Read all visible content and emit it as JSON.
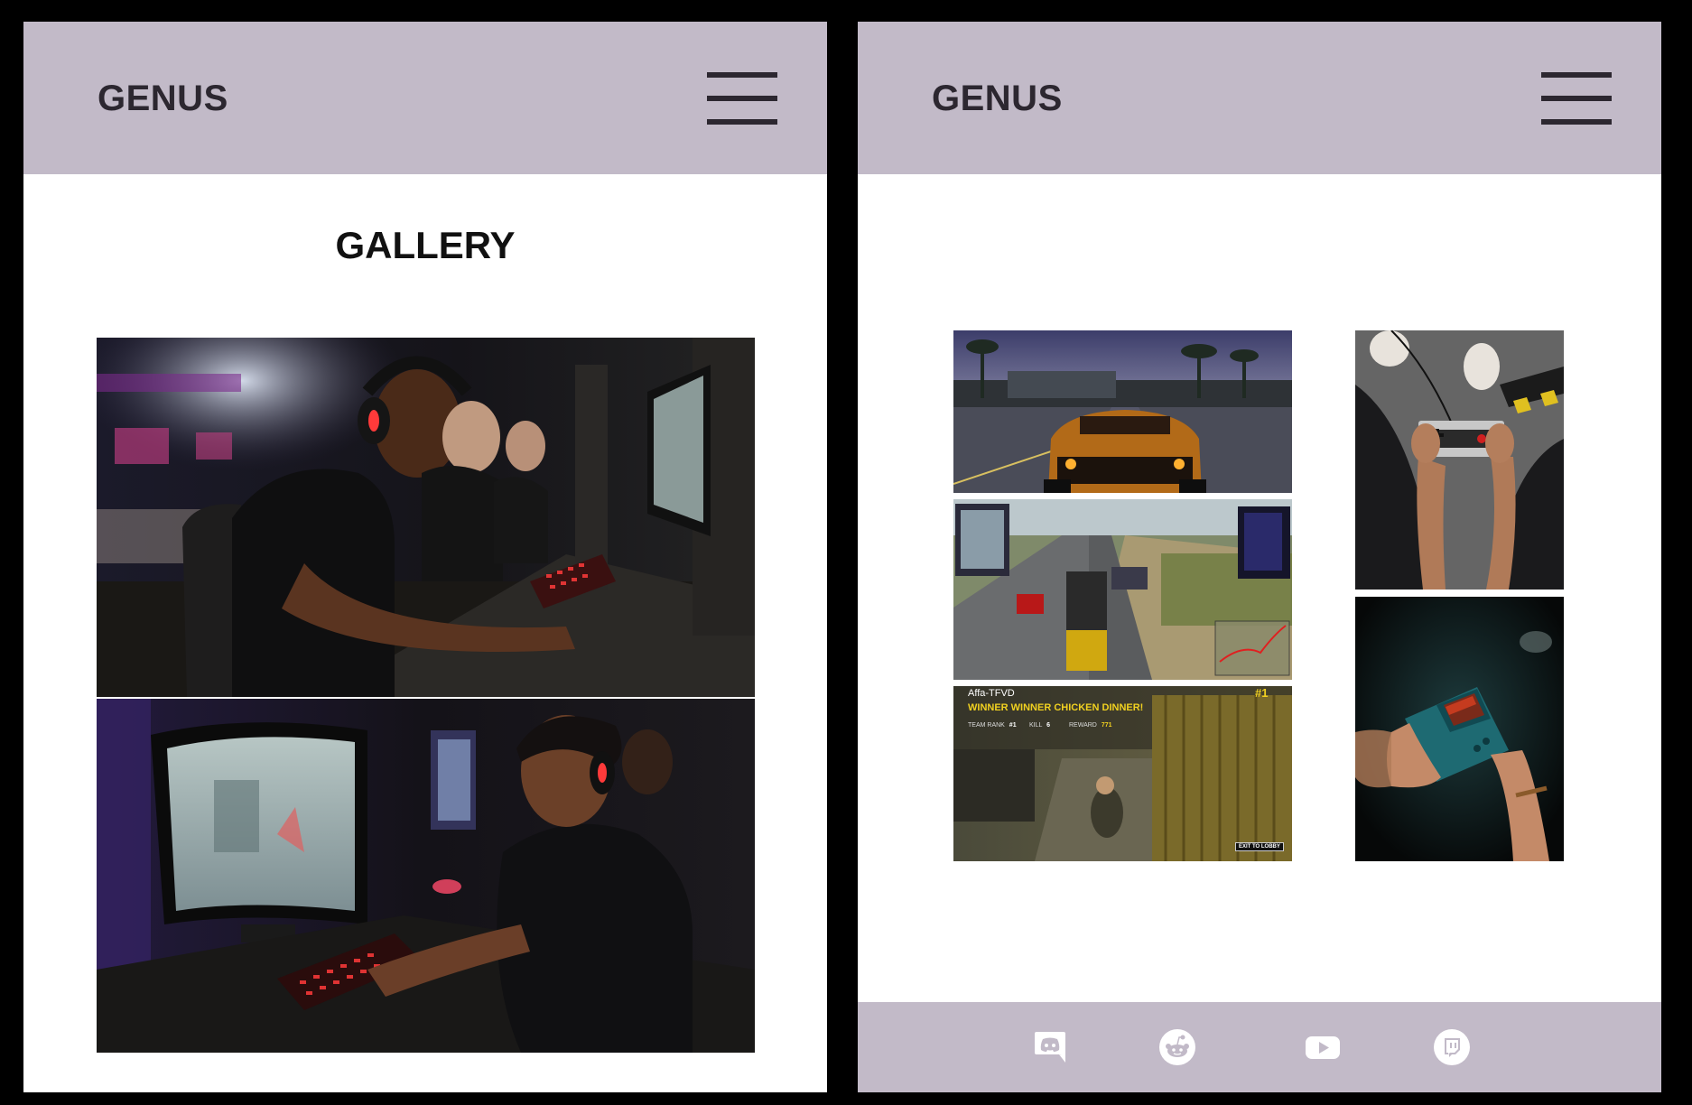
{
  "left_screen": {
    "brand": "GENUS",
    "menu_icon": "hamburger-menu-icon",
    "title": "GALLERY",
    "photos": [
      {
        "subject": "man-playing-pc-game-photo"
      },
      {
        "subject": "teen-playing-pc-game-photo"
      }
    ]
  },
  "right_screen": {
    "brand": "GENUS",
    "menu_icon": "hamburger-menu-icon",
    "photos": [
      {
        "subject": "racing-game-screenshot"
      },
      {
        "subject": "highway-battle-royale-screenshot"
      },
      {
        "subject": "battle-royale-victory-screenshot",
        "overlay": {
          "player": "Affa-TFVD",
          "banner": "WINNER WINNER CHICKEN DINNER!",
          "rank": "#1",
          "team_rank": "TEAM RANK",
          "team_rank_value": "#1",
          "kill": "KILL",
          "kill_value": "6",
          "reward": "REWARD",
          "reward_value": "771",
          "exit_button": "EXIT TO LOBBY"
        }
      },
      {
        "subject": "nes-controller-photo"
      },
      {
        "subject": "handheld-console-photo"
      }
    ],
    "footer": {
      "social_icons": [
        "discord-icon",
        "reddit-icon",
        "youtube-icon",
        "twitch-icon"
      ]
    }
  },
  "colors": {
    "header_bg": "#c2bac8",
    "brand_text": "#2c2730",
    "page_bg": "#ffffff",
    "frame_bg": "#000000",
    "icon_color": "#ffffff"
  }
}
